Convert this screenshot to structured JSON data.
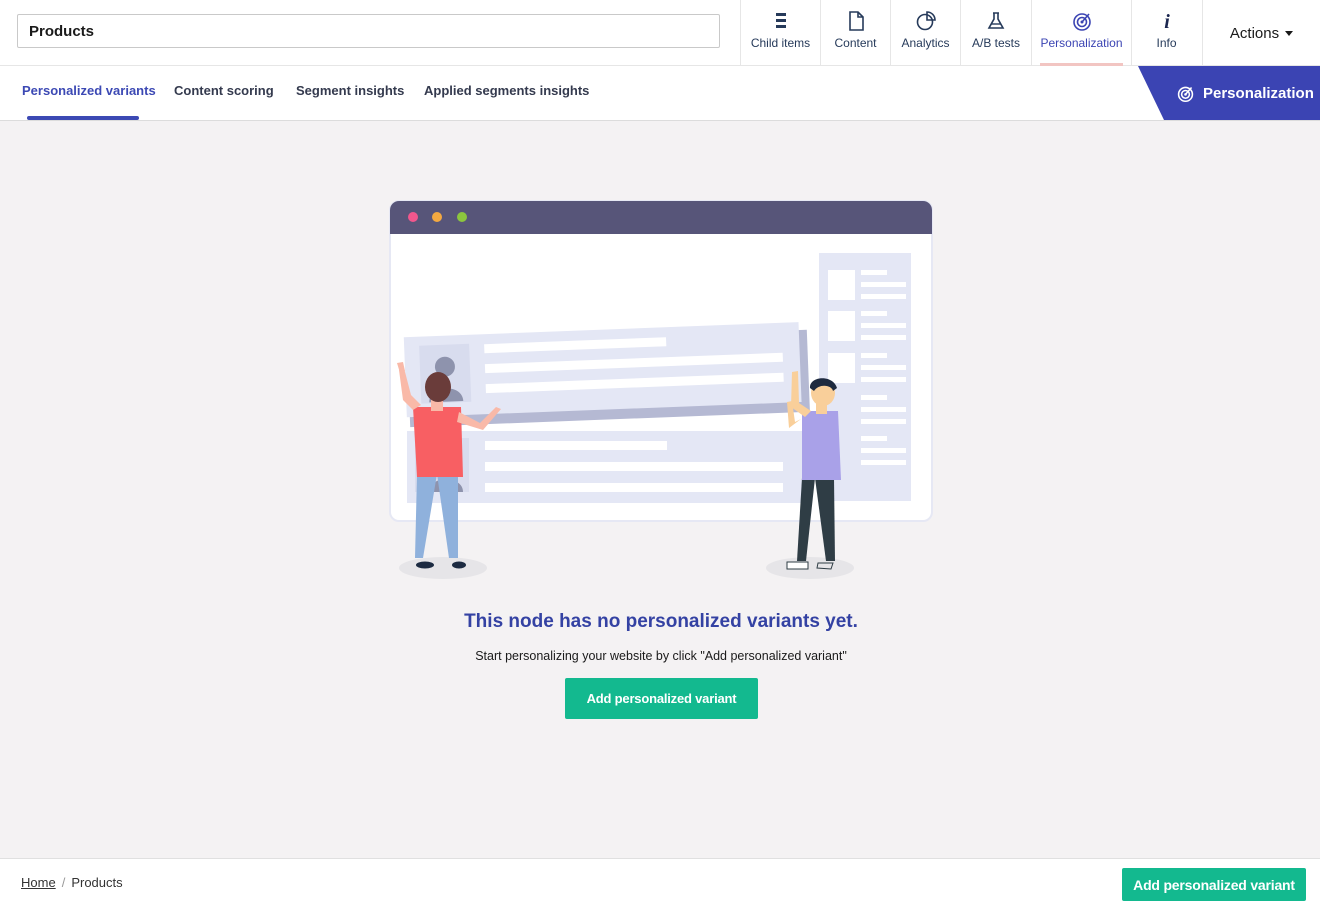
{
  "header": {
    "page_name": "Products",
    "apps": [
      {
        "label": "Child items",
        "icon": "list-icon"
      },
      {
        "label": "Content",
        "icon": "document-icon"
      },
      {
        "label": "Analytics",
        "icon": "pie-chart-icon"
      },
      {
        "label": "A/B tests",
        "icon": "flask-icon"
      },
      {
        "label": "Personalization",
        "icon": "target-icon"
      },
      {
        "label": "Info",
        "icon": "info-icon"
      }
    ],
    "actions_label": "Actions"
  },
  "tabs": [
    {
      "label": "Personalized variants",
      "active": true
    },
    {
      "label": "Content scoring",
      "active": false
    },
    {
      "label": "Segment insights",
      "active": false
    },
    {
      "label": "Applied segments insights",
      "active": false
    }
  ],
  "app_banner": {
    "label": "Personalization",
    "icon": "target-icon"
  },
  "empty_state": {
    "title": "This node has no personalized variants yet.",
    "subtitle": "Start personalizing your website by click \"Add personalized variant\"",
    "button_label": "Add personalized variant"
  },
  "footer": {
    "breadcrumb": [
      "Home",
      "Products"
    ],
    "button_label": "Add personalized variant"
  },
  "colors": {
    "accent": "#3b44b3",
    "green": "#13b98f",
    "background": "#f4f2f3",
    "active_app_marker": "#f2c5c2"
  }
}
